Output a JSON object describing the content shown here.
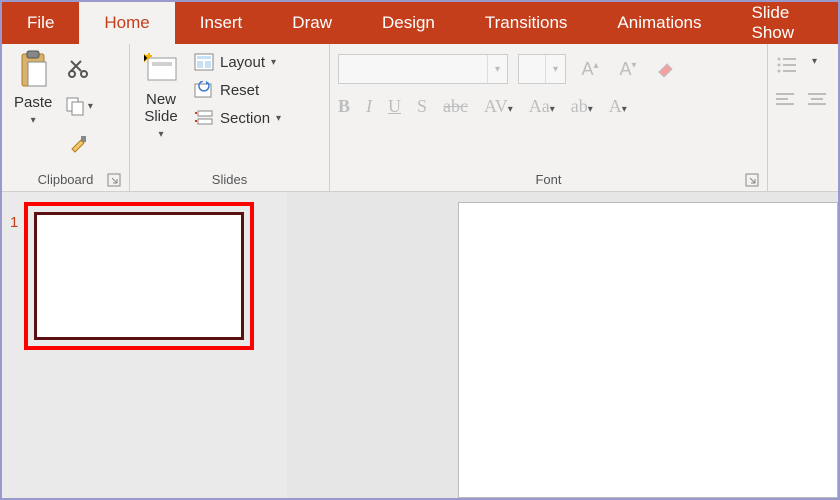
{
  "tabs": {
    "file": "File",
    "home": "Home",
    "insert": "Insert",
    "draw": "Draw",
    "design": "Design",
    "transitions": "Transitions",
    "animations": "Animations",
    "slideshow": "Slide Show"
  },
  "ribbon": {
    "clipboard": {
      "paste": "Paste",
      "label": "Clipboard"
    },
    "slides": {
      "newslide": "New Slide",
      "layout": "Layout",
      "reset": "Reset",
      "section": "Section",
      "label": "Slides"
    },
    "font": {
      "label": "Font"
    }
  },
  "thumbs": {
    "n1": "1"
  }
}
